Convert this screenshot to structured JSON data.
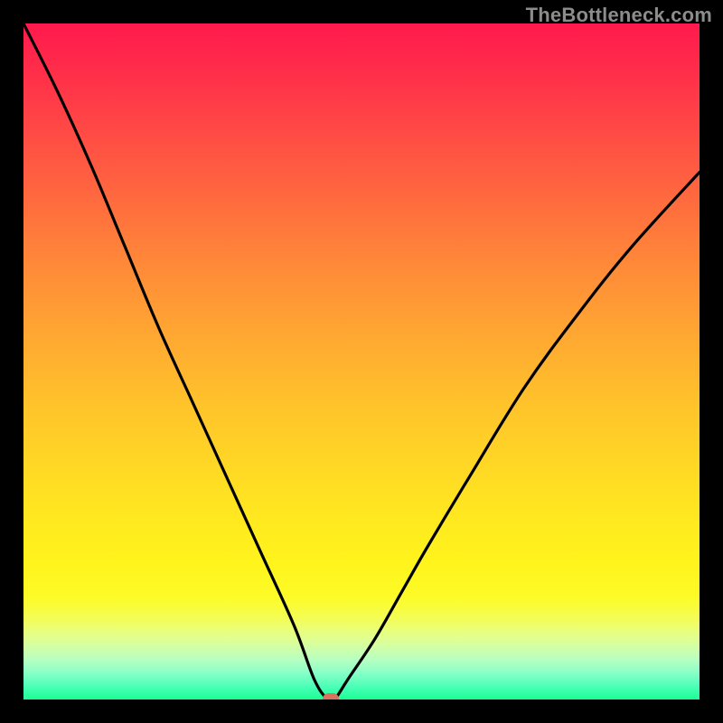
{
  "watermark": {
    "text": "TheBottleneck.com"
  },
  "chart_data": {
    "type": "line",
    "title": "",
    "xlabel": "",
    "ylabel": "",
    "xlim": [
      0,
      100
    ],
    "ylim": [
      0,
      100
    ],
    "grid": false,
    "legend": false,
    "series": [
      {
        "name": "bottleneck-curve",
        "x": [
          0,
          5,
          10,
          15,
          20,
          25,
          30,
          35,
          40,
          43,
          45,
          46,
          48,
          52,
          56,
          60,
          66,
          74,
          82,
          90,
          100
        ],
        "values": [
          100,
          90,
          79,
          67,
          55,
          44,
          33,
          22,
          11,
          3,
          0,
          0,
          3,
          9,
          16,
          23,
          33,
          46,
          57,
          67,
          78
        ]
      }
    ],
    "vertex": {
      "x": 45.5,
      "y": 0
    },
    "colors": {
      "curve": "#000000",
      "vertex": "#d8735e",
      "gradient_top": "#ff1a4d",
      "gradient_mid": "#ffd924",
      "gradient_bottom": "#1aff94",
      "frame": "#000000"
    }
  }
}
